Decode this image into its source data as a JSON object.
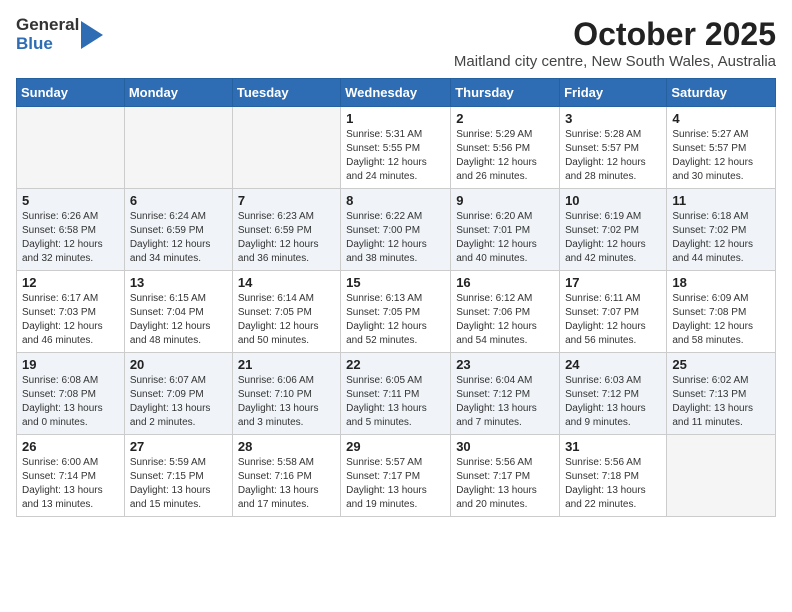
{
  "header": {
    "logo_general": "General",
    "logo_blue": "Blue",
    "title": "October 2025",
    "subtitle": "Maitland city centre, New South Wales, Australia"
  },
  "weekdays": [
    "Sunday",
    "Monday",
    "Tuesday",
    "Wednesday",
    "Thursday",
    "Friday",
    "Saturday"
  ],
  "weeks": [
    [
      {
        "day": "",
        "empty": true
      },
      {
        "day": "",
        "empty": true
      },
      {
        "day": "",
        "empty": true
      },
      {
        "day": "1",
        "sunrise": "5:31 AM",
        "sunset": "5:55 PM",
        "daylight": "12 hours and 24 minutes."
      },
      {
        "day": "2",
        "sunrise": "5:29 AM",
        "sunset": "5:56 PM",
        "daylight": "12 hours and 26 minutes."
      },
      {
        "day": "3",
        "sunrise": "5:28 AM",
        "sunset": "5:57 PM",
        "daylight": "12 hours and 28 minutes."
      },
      {
        "day": "4",
        "sunrise": "5:27 AM",
        "sunset": "5:57 PM",
        "daylight": "12 hours and 30 minutes."
      }
    ],
    [
      {
        "day": "5",
        "sunrise": "6:26 AM",
        "sunset": "6:58 PM",
        "daylight": "12 hours and 32 minutes."
      },
      {
        "day": "6",
        "sunrise": "6:24 AM",
        "sunset": "6:59 PM",
        "daylight": "12 hours and 34 minutes."
      },
      {
        "day": "7",
        "sunrise": "6:23 AM",
        "sunset": "6:59 PM",
        "daylight": "12 hours and 36 minutes."
      },
      {
        "day": "8",
        "sunrise": "6:22 AM",
        "sunset": "7:00 PM",
        "daylight": "12 hours and 38 minutes."
      },
      {
        "day": "9",
        "sunrise": "6:20 AM",
        "sunset": "7:01 PM",
        "daylight": "12 hours and 40 minutes."
      },
      {
        "day": "10",
        "sunrise": "6:19 AM",
        "sunset": "7:02 PM",
        "daylight": "12 hours and 42 minutes."
      },
      {
        "day": "11",
        "sunrise": "6:18 AM",
        "sunset": "7:02 PM",
        "daylight": "12 hours and 44 minutes."
      }
    ],
    [
      {
        "day": "12",
        "sunrise": "6:17 AM",
        "sunset": "7:03 PM",
        "daylight": "12 hours and 46 minutes."
      },
      {
        "day": "13",
        "sunrise": "6:15 AM",
        "sunset": "7:04 PM",
        "daylight": "12 hours and 48 minutes."
      },
      {
        "day": "14",
        "sunrise": "6:14 AM",
        "sunset": "7:05 PM",
        "daylight": "12 hours and 50 minutes."
      },
      {
        "day": "15",
        "sunrise": "6:13 AM",
        "sunset": "7:05 PM",
        "daylight": "12 hours and 52 minutes."
      },
      {
        "day": "16",
        "sunrise": "6:12 AM",
        "sunset": "7:06 PM",
        "daylight": "12 hours and 54 minutes."
      },
      {
        "day": "17",
        "sunrise": "6:11 AM",
        "sunset": "7:07 PM",
        "daylight": "12 hours and 56 minutes."
      },
      {
        "day": "18",
        "sunrise": "6:09 AM",
        "sunset": "7:08 PM",
        "daylight": "12 hours and 58 minutes."
      }
    ],
    [
      {
        "day": "19",
        "sunrise": "6:08 AM",
        "sunset": "7:08 PM",
        "daylight": "13 hours and 0 minutes."
      },
      {
        "day": "20",
        "sunrise": "6:07 AM",
        "sunset": "7:09 PM",
        "daylight": "13 hours and 2 minutes."
      },
      {
        "day": "21",
        "sunrise": "6:06 AM",
        "sunset": "7:10 PM",
        "daylight": "13 hours and 3 minutes."
      },
      {
        "day": "22",
        "sunrise": "6:05 AM",
        "sunset": "7:11 PM",
        "daylight": "13 hours and 5 minutes."
      },
      {
        "day": "23",
        "sunrise": "6:04 AM",
        "sunset": "7:12 PM",
        "daylight": "13 hours and 7 minutes."
      },
      {
        "day": "24",
        "sunrise": "6:03 AM",
        "sunset": "7:12 PM",
        "daylight": "13 hours and 9 minutes."
      },
      {
        "day": "25",
        "sunrise": "6:02 AM",
        "sunset": "7:13 PM",
        "daylight": "13 hours and 11 minutes."
      }
    ],
    [
      {
        "day": "26",
        "sunrise": "6:00 AM",
        "sunset": "7:14 PM",
        "daylight": "13 hours and 13 minutes."
      },
      {
        "day": "27",
        "sunrise": "5:59 AM",
        "sunset": "7:15 PM",
        "daylight": "13 hours and 15 minutes."
      },
      {
        "day": "28",
        "sunrise": "5:58 AM",
        "sunset": "7:16 PM",
        "daylight": "13 hours and 17 minutes."
      },
      {
        "day": "29",
        "sunrise": "5:57 AM",
        "sunset": "7:17 PM",
        "daylight": "13 hours and 19 minutes."
      },
      {
        "day": "30",
        "sunrise": "5:56 AM",
        "sunset": "7:17 PM",
        "daylight": "13 hours and 20 minutes."
      },
      {
        "day": "31",
        "sunrise": "5:56 AM",
        "sunset": "7:18 PM",
        "daylight": "13 hours and 22 minutes."
      },
      {
        "day": "",
        "empty": true
      }
    ]
  ]
}
